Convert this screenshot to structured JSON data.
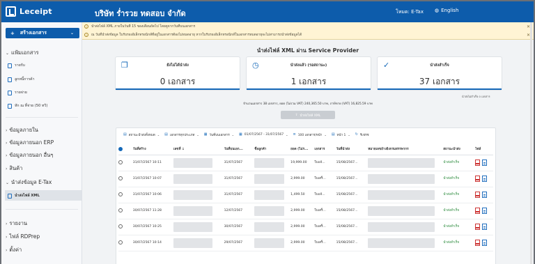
{
  "app": {
    "logo": "Leceipt",
    "company": "บริษัท ร่ำรวย ทดสอบ จำกัด",
    "mode": "โหมด: E-Tax",
    "language": "English"
  },
  "alerts": [
    "นำส่งไฟล์ XML ภายในวันที่ 15 ของเดือนถัดไป โดยดูจากวันที่บนเอกสาร",
    "ณ วันที่นำส่งข้อมูล ใบรับรองอิเล็กทรอนิกส์ที่อยู่ในเอกสารต้องไม่หมดอายุ หากใบรับรองอิเล็กทรอนิกส์ในเอกสารหมดอายุจะไม่สามารถนำส่งข้อมูลได้"
  ],
  "sidebar": {
    "create_label": "สร้างเอกสาร",
    "documents_section": "แฟ้มเอกสาร",
    "document_items": [
      "รายรับ",
      "ลูกหนี้การค้า",
      "รายจ่าย",
      "หัก ณ ที่จ่าย (50 ทวิ)"
    ],
    "sections": [
      "ข้อมูลภายใน",
      "ข้อมูลภายนอก ERP",
      "ข้อมูลภายนอก อื่นๆ",
      "สินค้า",
      "นำส่งข้อมูล E-Tax"
    ],
    "active_item": "นำส่งไฟล์ XML",
    "bottom_sections": [
      "รายงาน",
      "ไฟล์ RDPrep",
      "ตั้งค่า"
    ]
  },
  "page": {
    "title": "นำส่งไฟล์ XML ผ่าน Service Provider",
    "cards": [
      {
        "label": "ยังไม่ได้นำส่ง",
        "value": "0 เอกสาร",
        "icon": "documents-icon"
      },
      {
        "label": "นำส่งแล้ว (รอสถานะ)",
        "value": "1 เอกสาร",
        "icon": "clock-icon"
      },
      {
        "label": "นำส่งสำเร็จ",
        "value": "37 เอกสาร",
        "icon": "check-circle-icon"
      }
    ],
    "failed_note": "นำส่งไม่สำเร็จ 0 เอกสาร",
    "summary": "จำนวนเอกสาร 38 เอกสาร, ยอด (ไม่รวม VAT) 240,365.50 บาท, ภาษีขาย (VAT) 16,825.59 บาท",
    "send_button": "นำส่งไฟล์ XML"
  },
  "toolbar": [
    "สถานะนำส่งทั้งหมด",
    "เอกสารทุกประเภท",
    "วันที่บนเอกสาร",
    "01/07/2567 - 31/07/2567",
    "100 เอกสาร/หน้า",
    "หน้า 1",
    "รีเฟรช"
  ],
  "table": {
    "headers": [
      "",
      "วันที่สร้าง",
      "เลขที่ ↓",
      "วันที่บนเอก...",
      "ชื่อลูกค้า",
      "ยอด (ไม่ร...",
      "เอกสาร",
      "วันที่นำส่ง",
      "หมายเลขอ้างอิงกรมสรรพากร",
      "สถานะนำส่ง",
      "ไฟล์"
    ],
    "rows": [
      {
        "created": "31/07/2567 10:11",
        "doc_date": "31/07/2567",
        "amount": "19,999.00",
        "doc": "ใบแจ้...",
        "sent": "15/08/2567...",
        "status": "นำส่งสำเร็จ"
      },
      {
        "created": "31/07/2567 10:07",
        "doc_date": "31/07/2567",
        "amount": "2,999.00",
        "doc": "ใบเสร็...",
        "sent": "15/08/2567...",
        "status": "นำส่งสำเร็จ"
      },
      {
        "created": "31/07/2567 10:06",
        "doc_date": "31/07/2567",
        "amount": "1,499.50",
        "doc": "ใบแจ้...",
        "sent": "15/08/2567...",
        "status": "นำส่งสำเร็จ"
      },
      {
        "created": "30/07/2567 11:28",
        "doc_date": "12/07/2567",
        "amount": "2,999.00",
        "doc": "ใบเสร็...",
        "sent": "15/08/2567...",
        "status": "นำส่งสำเร็จ"
      },
      {
        "created": "30/07/2567 10:25",
        "doc_date": "30/07/2567",
        "amount": "2,999.00",
        "doc": "ใบเสร็...",
        "sent": "15/08/2567...",
        "status": "นำส่งสำเร็จ"
      },
      {
        "created": "30/07/2567 10:14",
        "doc_date": "29/07/2567",
        "amount": "2,999.00",
        "doc": "ใบเสร็...",
        "sent": "15/08/2567...",
        "status": "นำส่งสำเร็จ"
      }
    ]
  },
  "colors": {
    "brand": "#0d5cab",
    "success": "#2a8a3b",
    "alert_bg": "#fff4d4"
  }
}
